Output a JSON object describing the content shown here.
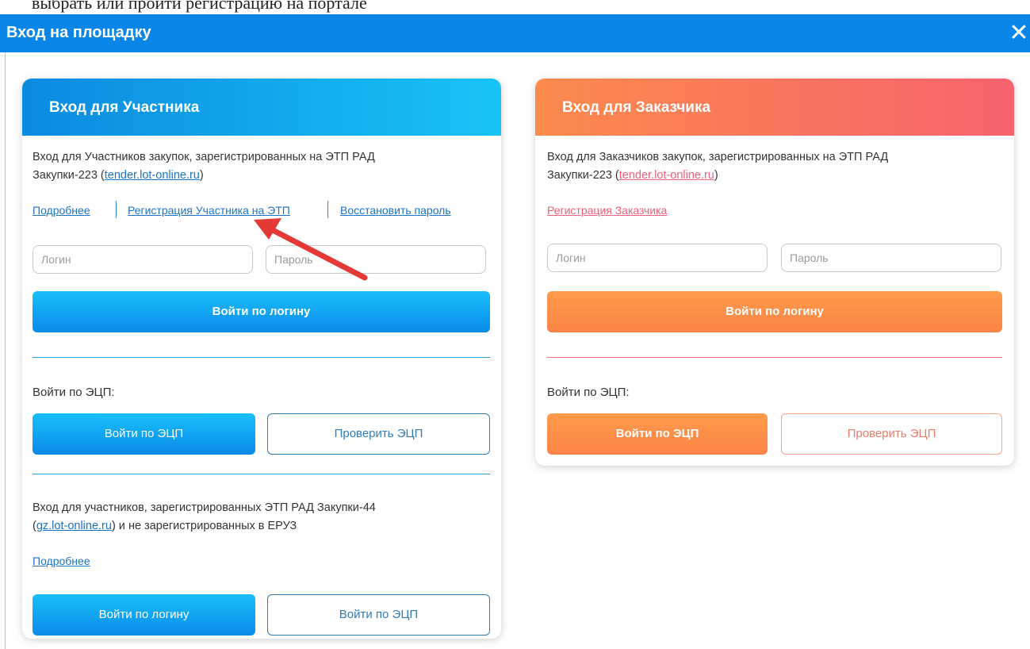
{
  "top_text": "выбрать или пройти регистрацию на портале",
  "modal": {
    "title": "Вход на площадку",
    "close_icon": "close-icon"
  },
  "participant": {
    "title": "Вход для Участника",
    "desc_line1": "Вход для Участников закупок, зарегистрированных на ЭТП РАД",
    "desc_line2_pre": "Закупки-223 (",
    "desc_link": "tender.lot-online.ru",
    "desc_line2_post": ")",
    "links": {
      "more": "Подробнее",
      "register": "Регистрация Участника на ЭТП",
      "restore": "Восстановить пароль"
    },
    "login_placeholder": "Логин",
    "password_placeholder": "Пароль",
    "login_button": "Войти по логину",
    "ecp_label": "Войти по ЭЦП:",
    "ecp_button": "Войти по ЭЦП",
    "check_ecp_button": "Проверить ЭЦП",
    "section2": {
      "desc_line1": "Вход для участников, зарегистрированных ЭТП РАД Закупки-44",
      "desc_line2_pre": "(",
      "desc_link": "gz.lot-online.ru",
      "desc_line2_post": ") и не зарегистрированных в ЕРУЗ",
      "more": "Подробнее",
      "login_button": "Войти по логину",
      "ecp_button": "Войти по ЭЦП"
    }
  },
  "customer": {
    "title": "Вход для Заказчика",
    "desc_line1": "Вход для Заказчиков закупок, зарегистрированных на ЭТП РАД",
    "desc_line2_pre": "Закупки-223 (",
    "desc_link": "tender.lot-online.ru",
    "desc_line2_post": ")",
    "register_link": "Регистрация Заказчика",
    "login_placeholder": "Логин",
    "password_placeholder": "Пароль",
    "login_button": "Войти по логину",
    "ecp_label": "Войти по ЭЦП:",
    "ecp_button": "Войти по ЭЦП",
    "check_ecp_button": "Проверить ЭЦП"
  },
  "colors": {
    "header": "#0a86e8",
    "participant_accent": "#19c0fa",
    "customer_accent": "#fb8448",
    "annotation_arrow": "#e53935"
  }
}
